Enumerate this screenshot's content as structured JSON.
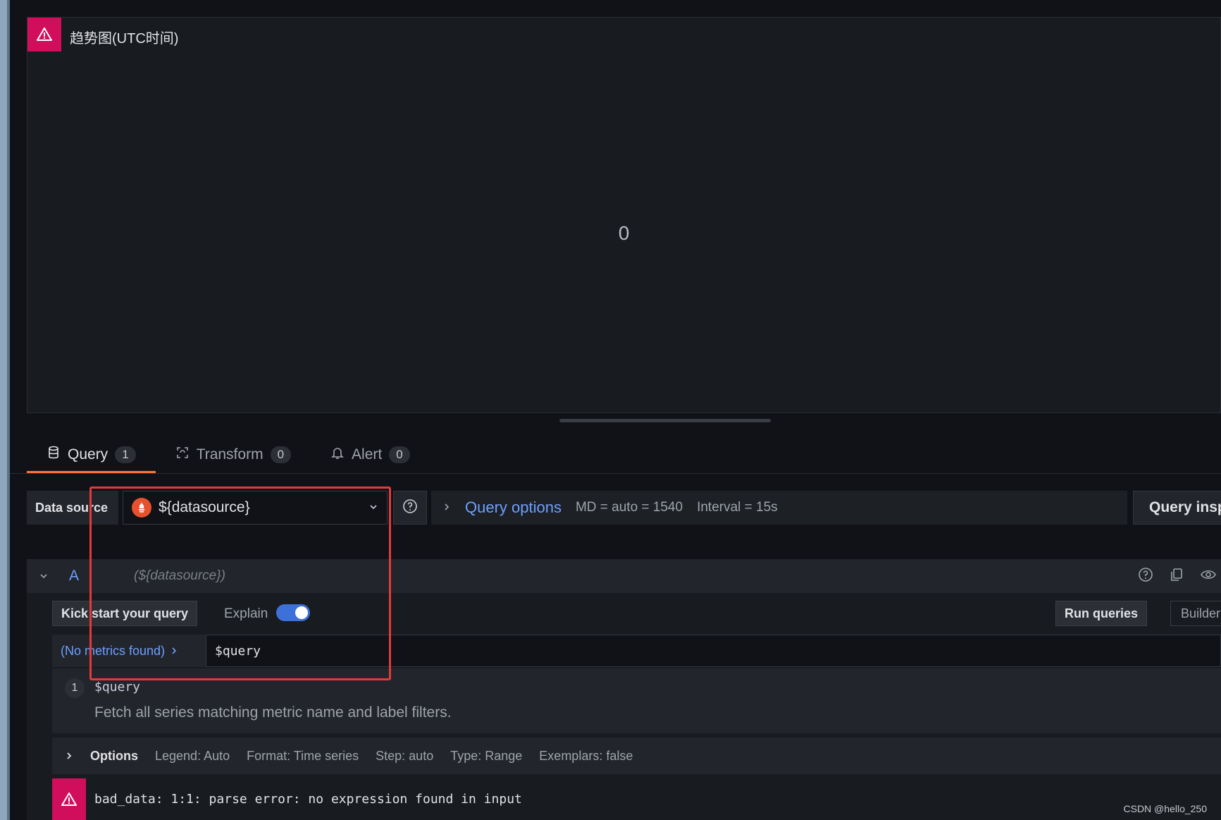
{
  "panel": {
    "title": "趋势图(UTC时间)",
    "value": "0"
  },
  "tabs": [
    {
      "label": "Query",
      "count": "1"
    },
    {
      "label": "Transform",
      "count": "0"
    },
    {
      "label": "Alert",
      "count": "0"
    }
  ],
  "datasource": {
    "label": "Data source",
    "selected": "${datasource}"
  },
  "query_options": {
    "link": "Query options",
    "md": "MD = auto = 1540",
    "interval": "Interval = 15s",
    "inspector": "Query insp"
  },
  "query_row": {
    "ref_id": "A",
    "ds_name": "(${datasource})",
    "kick_start": "Kick start your query",
    "explain_label": "Explain",
    "explain_on": true,
    "run_queries": "Run queries",
    "builder": "Builder",
    "metrics_browser": "(No metrics found)",
    "query_value": "$query",
    "explain_step": {
      "num": "1",
      "code": "$query",
      "desc": "Fetch all series matching metric name and label filters."
    },
    "options": {
      "title": "Options",
      "legend": "Legend: Auto",
      "format": "Format: Time series",
      "step": "Step: auto",
      "type": "Type: Range",
      "exemplars": "Exemplars: false"
    },
    "error": "bad_data: 1:1: parse error: no expression found in input"
  },
  "watermark": "CSDN @hello_250",
  "colors": {
    "accent": "#ff7433",
    "link": "#6e9fff",
    "error": "#d10e5c",
    "highlight": "#e53a3a",
    "toggle": "#3d71d9"
  }
}
